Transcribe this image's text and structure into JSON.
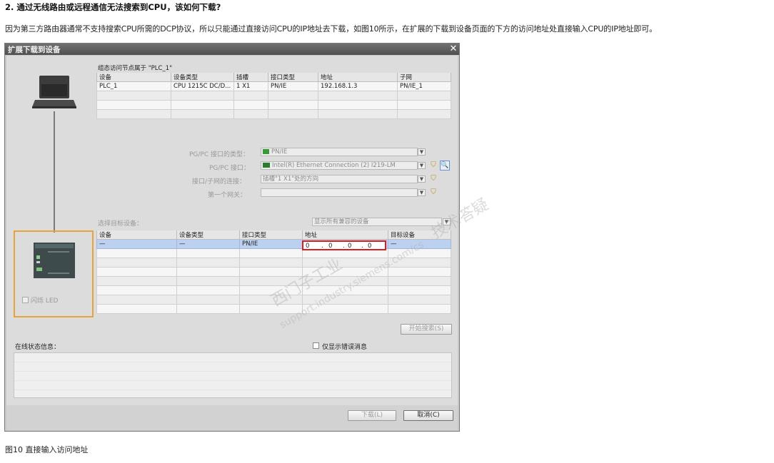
{
  "article": {
    "heading": "2. 通过无线路由或远程通信无法搜索到CPU，该如何下载?",
    "paragraph": "因为第三方路由器通常不支持搜索CPU所需的DCP协议，所以只能通过直接访问CPU的IP地址去下载，如图10所示，在扩展的下载到设备页面的下方的访问地址处直接输入CPU的IP地址即可。",
    "caption": "图10 直接输入访问地址"
  },
  "dialog": {
    "title": "扩展下载到设备",
    "close_glyph": "✕",
    "config_title": "组态访问节点属于 \"PLC_1\"",
    "config_headers": [
      "设备",
      "设备类型",
      "插槽",
      "接口类型",
      "地址",
      "子网"
    ],
    "config_rows": [
      [
        "PLC_1",
        "CPU 1215C DC/D...",
        "1 X1",
        "PN/IE",
        "192.168.1.3",
        "PN/IE_1"
      ],
      [
        "",
        "",
        "",
        "",
        "",
        ""
      ],
      [
        "",
        "",
        "",
        "",
        "",
        ""
      ],
      [
        "",
        "",
        "",
        "",
        "",
        ""
      ]
    ],
    "pgpc_type_label": "PG/PC 接口的类型：",
    "pgpc_type_value": "PN/IE",
    "pgpc_if_label": "PG/PC 接口：",
    "pgpc_if_value": "Intel(R) Ethernet Connection (2) I219-LM",
    "subnet_conn_label": "接口/子网的连接：",
    "subnet_conn_value": "插槽\"1 X1\"处的方向",
    "gateway_label": "第一个网关：",
    "gateway_value": "",
    "select_target_label": "选择目标设备：",
    "filter_value": "显示所有兼容的设备",
    "target_headers": [
      "设备",
      "设备类型",
      "接口类型",
      "地址",
      "目标设备"
    ],
    "target_row": [
      "—",
      "—",
      "PN/IE",
      "—"
    ],
    "ip_octets": [
      "0",
      "0",
      "0",
      "0"
    ],
    "blink_led_label": "闪烁 LED",
    "start_search_label": "开始搜索(S)",
    "online_status_label": "在线状态信息：",
    "show_errors_label": "仅显示错误消息",
    "download_label": "下载(L)",
    "cancel_label": "取消(C)",
    "highlight_color": "#e8a33a",
    "ip_box_color": "#d91e1e"
  },
  "watermarks": [
    "西门子工业",
    "技术答疑",
    "support.industry.siemens.com/cs"
  ]
}
